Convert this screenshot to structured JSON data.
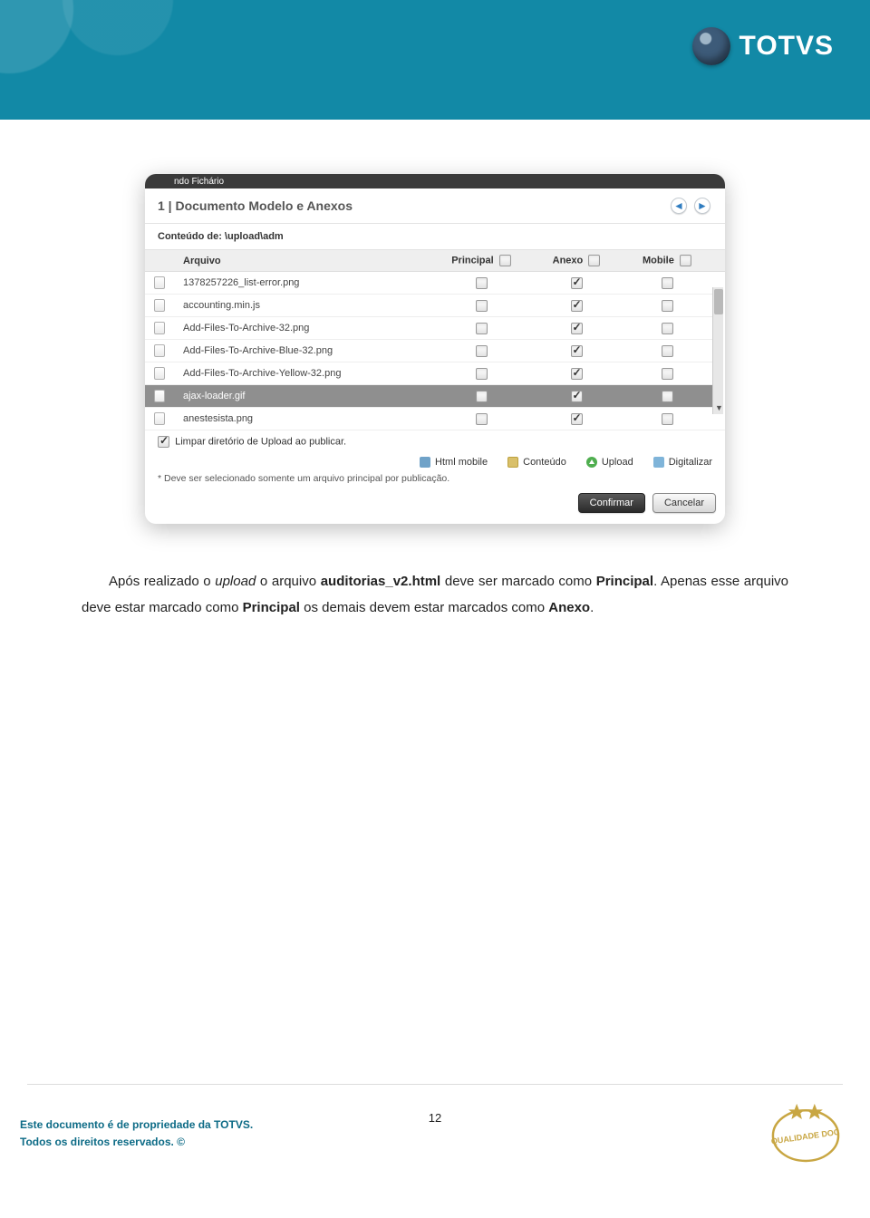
{
  "header": {
    "brand": "TOTVS"
  },
  "dialog": {
    "windowTitle": "ndo Fichário",
    "title": "1 | Documento Modelo e Anexos",
    "breadcrumb": "Conteúdo de: \\upload\\adm",
    "columns": {
      "arquivo": "Arquivo",
      "principal": "Principal",
      "anexo": "Anexo",
      "mobile": "Mobile"
    },
    "rows": [
      {
        "name": "1378257226_list-error.png",
        "principal": false,
        "anexo": true,
        "mobile": false,
        "selected": false
      },
      {
        "name": "accounting.min.js",
        "principal": false,
        "anexo": true,
        "mobile": false,
        "selected": false
      },
      {
        "name": "Add-Files-To-Archive-32.png",
        "principal": false,
        "anexo": true,
        "mobile": false,
        "selected": false
      },
      {
        "name": "Add-Files-To-Archive-Blue-32.png",
        "principal": false,
        "anexo": true,
        "mobile": false,
        "selected": false
      },
      {
        "name": "Add-Files-To-Archive-Yellow-32.png",
        "principal": false,
        "anexo": true,
        "mobile": false,
        "selected": false
      },
      {
        "name": "ajax-loader.gif",
        "principal": false,
        "anexo": true,
        "mobile": false,
        "selected": true
      },
      {
        "name": "anestesista.png",
        "principal": false,
        "anexo": true,
        "mobile": false,
        "selected": false
      }
    ],
    "clearUpload": {
      "checked": true,
      "label": "Limpar diretório de Upload ao publicar."
    },
    "actions": {
      "html": "Html mobile",
      "conteudo": "Conteúdo",
      "upload": "Upload",
      "digitalizar": "Digitalizar"
    },
    "note": "* Deve ser selecionado somente um arquivo principal por publicação.",
    "confirm": "Confirmar",
    "cancel": "Cancelar"
  },
  "paragraph": {
    "p1a": "Após realizado o ",
    "p1_em": "upload",
    "p1b": " o arquivo ",
    "p1_b1": "auditorias_v2.html",
    "p1c": " deve ser marcado como ",
    "p1_b2": "Principal",
    "p1d": ". Apenas esse arquivo deve estar marcado como ",
    "p1_b3": "Principal",
    "p1e": " os demais devem estar marcados como ",
    "p1_b4": "Anexo",
    "p1f": "."
  },
  "footer": {
    "pageNumber": "12",
    "line1": "Este documento é de propriedade da TOTVS.",
    "line2": "Todos os direitos reservados. ©",
    "stamp": "QUALIDADE DOC"
  }
}
